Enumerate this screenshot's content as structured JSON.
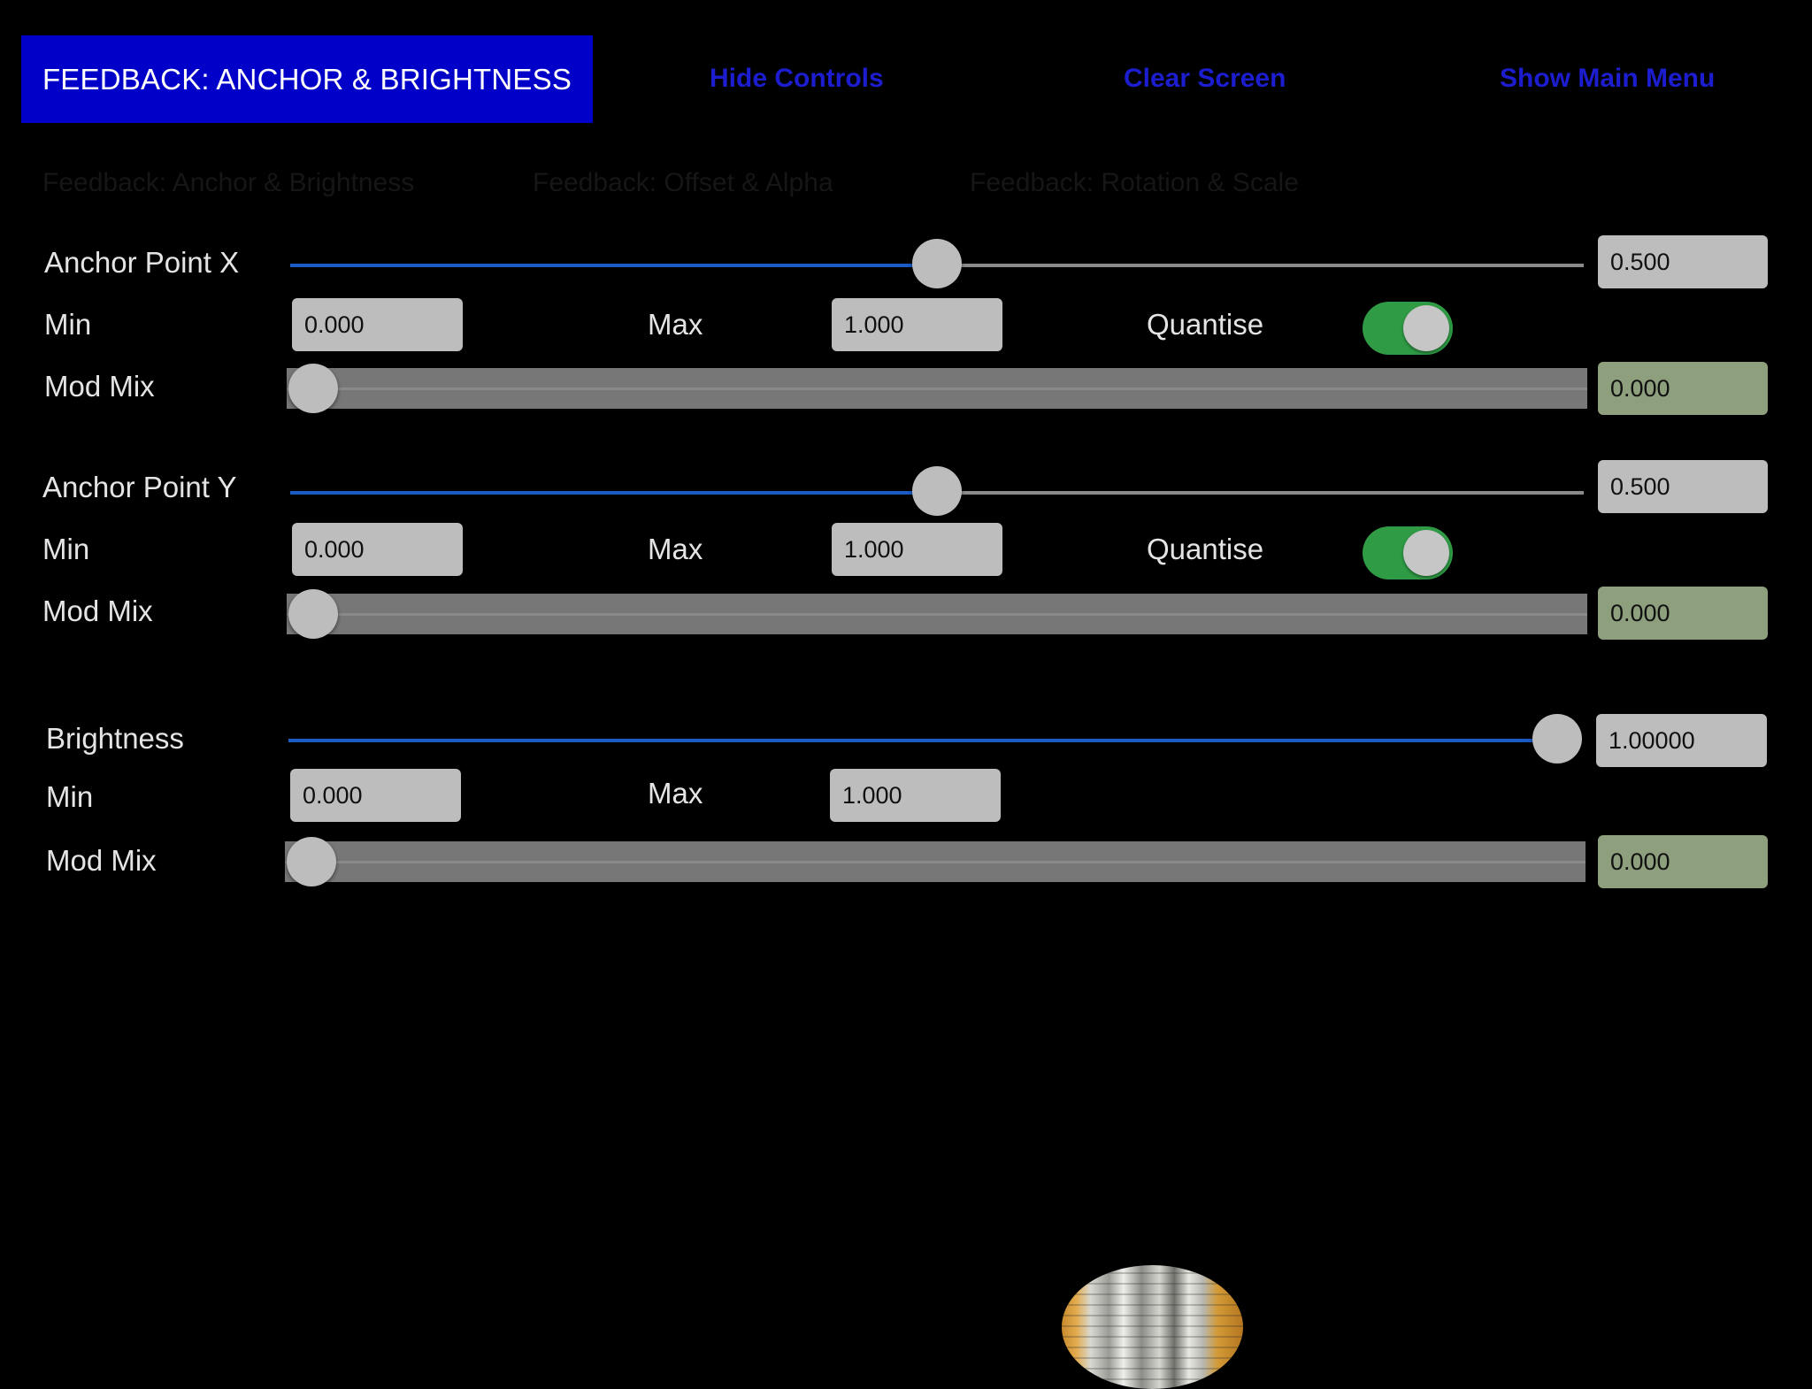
{
  "header": {
    "title": "FEEDBACK: ANCHOR & BRIGHTNESS",
    "hide_controls": "Hide Controls",
    "clear_screen": "Clear Screen",
    "show_main_menu": "Show Main Menu"
  },
  "tabs": [
    {
      "label": "Feedback: Anchor & Brightness"
    },
    {
      "label": "Feedback: Offset & Alpha"
    },
    {
      "label": "Feedback: Rotation & Scale"
    }
  ],
  "colors": {
    "title_bg": "#0000c8",
    "link": "#1d1dd0",
    "slider_fill": "#1a5bc4",
    "toggle_on": "#2f9b45",
    "mod_field": "#8d9f7c"
  },
  "controls": [
    {
      "label": "Anchor Point X",
      "value": "0.500",
      "slider_fraction": 0.5,
      "min_label": "Min",
      "min": "0.000",
      "max_label": "Max",
      "max": "1.000",
      "quantise_label": "Quantise",
      "quantise": true,
      "mod_label": "Mod Mix",
      "mod": "0.000",
      "mod_fraction": 0.0
    },
    {
      "label": "Anchor Point Y",
      "value": "0.500",
      "slider_fraction": 0.5,
      "min_label": "Min",
      "min": "0.000",
      "max_label": "Max",
      "max": "1.000",
      "quantise_label": "Quantise",
      "quantise": true,
      "mod_label": "Mod Mix",
      "mod": "0.000",
      "mod_fraction": 0.0
    },
    {
      "label": "Brightness",
      "value": "1.00000",
      "slider_fraction": 1.0,
      "min_label": "Min",
      "min": "0.000",
      "max_label": "Max",
      "max": "1.000",
      "mod_label": "Mod Mix",
      "mod": "0.000",
      "mod_fraction": 0.0
    }
  ]
}
